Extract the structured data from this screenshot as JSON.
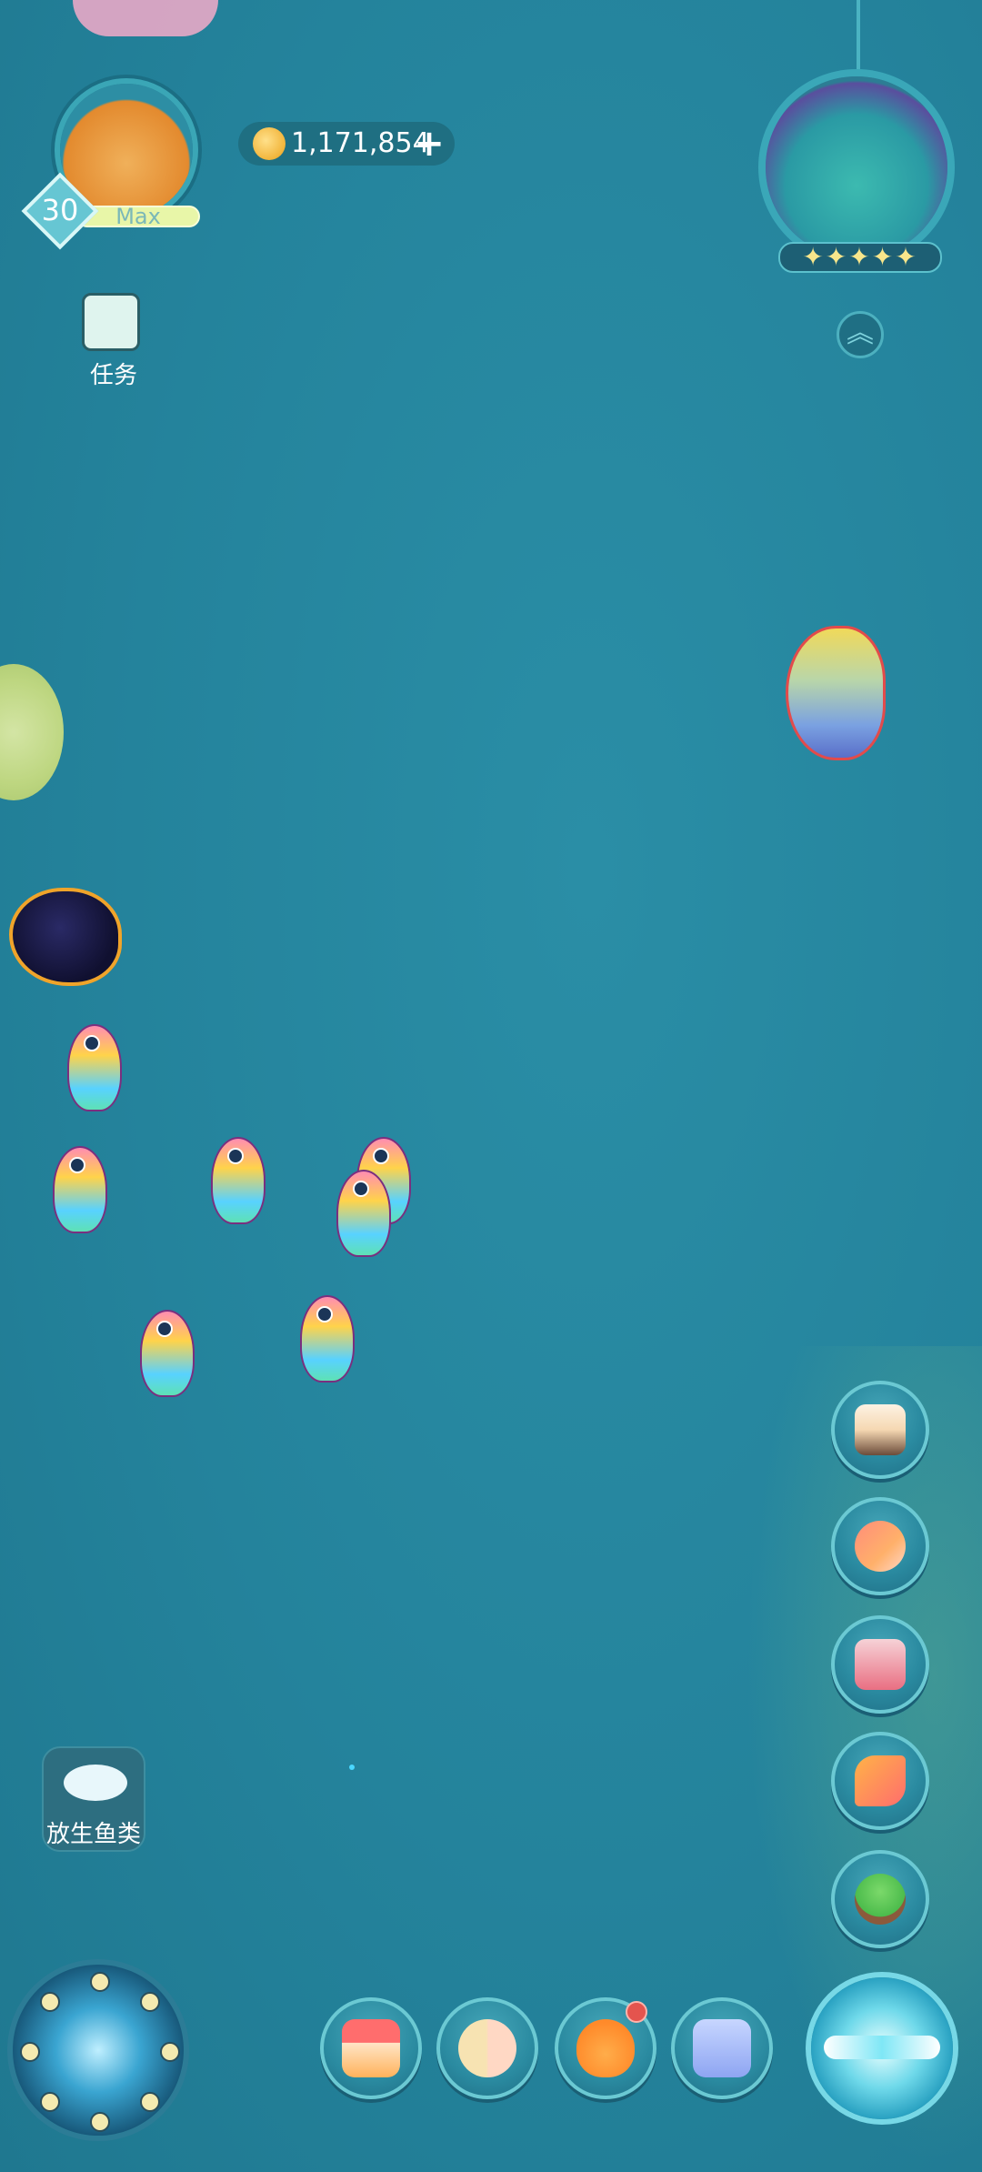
{
  "profile": {
    "level": "30",
    "xp_label": "Max"
  },
  "currency": {
    "coins": "1,171,854",
    "add_symbol": "+"
  },
  "task": {
    "label": "任务"
  },
  "orb": {
    "stars": "✦✦✦✦✦",
    "expand_symbol": "︽"
  },
  "left_panel": {
    "release_fish_label": "放生鱼类"
  },
  "icons": {
    "camera": "camera-icon",
    "announcement": "megaphone-icon",
    "collection_book": "book-icon",
    "hammer": "hammer-icon",
    "sprout": "sprout-icon",
    "shop": "shop-icon",
    "friends": "friends-icon",
    "pet": "pet-icon",
    "backpack": "bag-icon",
    "compass": "compass-icon",
    "dial": "moon-dial-icon",
    "release": "fish-release-icon"
  },
  "colors": {
    "ocean": "#24839c",
    "accent": "#6bc9d3",
    "notification": "#e4544e",
    "coin": "#f2b53b"
  }
}
